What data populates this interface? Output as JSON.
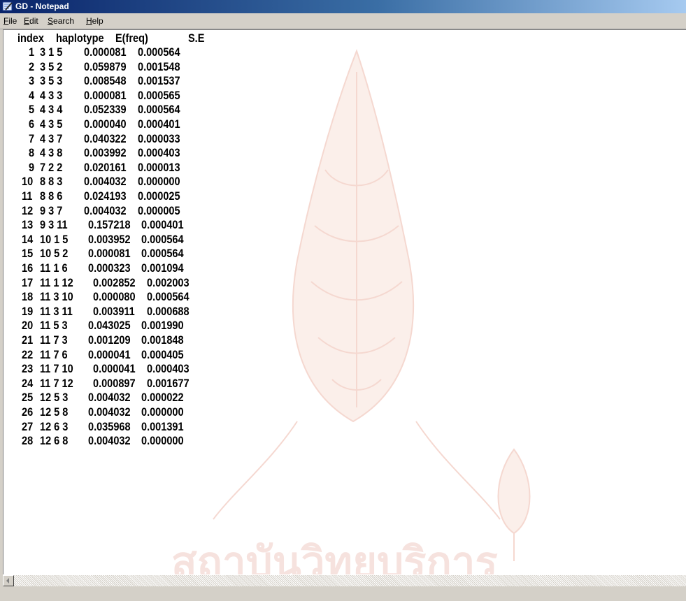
{
  "window": {
    "title": "GD - Notepad"
  },
  "menu": [
    {
      "pre": "",
      "mn": "F",
      "post": "ile"
    },
    {
      "pre": "",
      "mn": "E",
      "post": "dit"
    },
    {
      "pre": "",
      "mn": "S",
      "post": "earch"
    },
    {
      "pre": "",
      "mn": "H",
      "post": "elp"
    }
  ],
  "headers": [
    "index",
    "haplotype",
    "E(freq)",
    "S.E"
  ],
  "rows": [
    [
      "1",
      "3 1 5",
      "0.000081",
      "0.000564"
    ],
    [
      "2",
      "3 5 2",
      "0.059879",
      "0.001548"
    ],
    [
      "3",
      "3 5 3",
      "0.008548",
      "0.001537"
    ],
    [
      "4",
      "4 3 3",
      "0.000081",
      "0.000565"
    ],
    [
      "5",
      "4 3 4",
      "0.052339",
      "0.000564"
    ],
    [
      "6",
      "4 3 5",
      "0.000040",
      "0.000401"
    ],
    [
      "7",
      "4 3 7",
      "0.040322",
      "0.000033"
    ],
    [
      "8",
      "4 3 8",
      "0.003992",
      "0.000403"
    ],
    [
      "9",
      "7 2 2",
      "0.020161",
      "0.000013"
    ],
    [
      "10",
      "8 8 3",
      "0.004032",
      "0.000000"
    ],
    [
      "11",
      "8 8 6",
      "0.024193",
      "0.000025"
    ],
    [
      "12",
      "9 3 7",
      "0.004032",
      "0.000005"
    ],
    [
      "13",
      "9 3 11",
      "0.157218",
      "0.000401"
    ],
    [
      "14",
      "10 1 5",
      "0.003952",
      "0.000564"
    ],
    [
      "15",
      "10 5 2",
      "0.000081",
      "0.000564"
    ],
    [
      "16",
      "11 1 6",
      "0.000323",
      "0.001094"
    ],
    [
      "17",
      "11 1 12",
      "0.002852",
      "0.002003"
    ],
    [
      "18",
      "11 3 10",
      "0.000080",
      "0.000564"
    ],
    [
      "19",
      "11 3 11",
      "0.003911",
      "0.000688"
    ],
    [
      "20",
      "11 5 3",
      "0.043025",
      "0.001990"
    ],
    [
      "21",
      "11 7 3",
      "0.001209",
      "0.001848"
    ],
    [
      "22",
      "11 7 6",
      "0.000041",
      "0.000405"
    ],
    [
      "23",
      "11 7 10",
      "0.000041",
      "0.000403"
    ],
    [
      "24",
      "11 7 12",
      "0.000897",
      "0.001677"
    ],
    [
      "25",
      "12 5 3",
      "0.004032",
      "0.000022"
    ],
    [
      "26",
      "12 5 8",
      "0.004032",
      "0.000000"
    ],
    [
      "27",
      "12 6 3",
      "0.035968",
      "0.001391"
    ],
    [
      "28",
      "12 6 8",
      "0.004032",
      "0.000000"
    ]
  ],
  "watermark_text": "สถาบันวิทยบริการ"
}
